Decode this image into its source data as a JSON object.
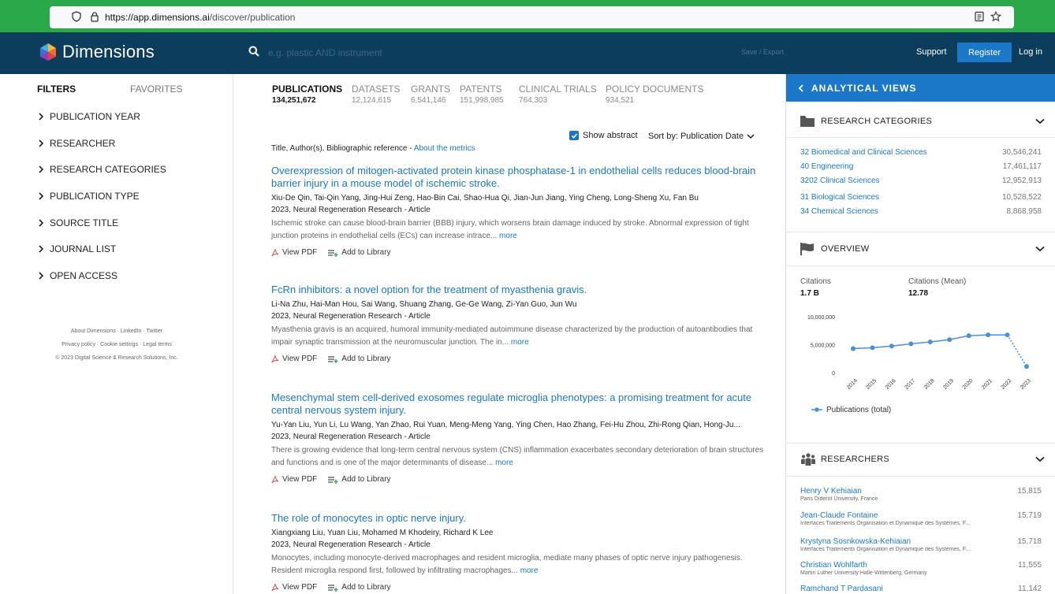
{
  "browser": {
    "url_host_prefix": "https://app.",
    "url_host": "dimensions.ai",
    "url_path": "/discover/publication"
  },
  "header": {
    "logo_text": "Dimensions",
    "search_placeholder": "e.g. plastic AND instrument",
    "save_export": "Save / Export",
    "support": "Support",
    "register": "Register",
    "login": "Log in",
    "colors": {
      "header_bg": "#0c3d5c",
      "accent": "#1b78c8",
      "browser_bar": "#2ba84a"
    }
  },
  "filters": {
    "tab_active": "FILTERS",
    "tab_other": "FAVORITES",
    "items": [
      {
        "label": "PUBLICATION YEAR"
      },
      {
        "label": "RESEARCHER"
      },
      {
        "label": "RESEARCH CATEGORIES"
      },
      {
        "label": "PUBLICATION TYPE"
      },
      {
        "label": "SOURCE TITLE"
      },
      {
        "label": "JOURNAL LIST"
      },
      {
        "label": "OPEN ACCESS"
      }
    ],
    "footer": {
      "line1": "About Dimensions · LinkedIn · Twitter",
      "line2": "Privacy policy · Cookie settings · Legal terms",
      "line3": "© 2023 Digital Science & Research Solutions, Inc."
    }
  },
  "main": {
    "tabs": [
      {
        "label": "PUBLICATIONS",
        "count": "134,251,672"
      },
      {
        "label": "DATASETS",
        "count": "12,124,615"
      },
      {
        "label": "GRANTS",
        "count": "6,541,146"
      },
      {
        "label": "PATENTS",
        "count": "151,998,985"
      },
      {
        "label": "CLINICAL TRIALS",
        "count": "764,303"
      },
      {
        "label": "POLICY DOCUMENTS",
        "count": "934,521"
      }
    ],
    "show_abstract": "Show abstract",
    "sort_by": "Sort by: Publication Date",
    "title_ref": "Title, Author(s), Bibliographic reference - ",
    "about_metrics": "About the metrics",
    "view_pdf": "View PDF",
    "add_to_library": "Add to Library",
    "more": "more",
    "results": [
      {
        "title": "Overexpression of mitogen-activated protein kinase phosphatase-1 in endothelial cells reduces blood-brain barrier injury in a mouse model of ischemic stroke.",
        "authors": "Xiu-De Qin, Tai-Qin Yang, Jing-Hui Zeng, Hao-Bin Cai, Shao-Hua Qi, Jian-Jun Jiang, Ying Cheng, Long-Sheng Xu, Fan Bu",
        "source": "2023, Neural Regeneration Research - Article",
        "abstract": "Ischemic stroke can cause blood-brain barrier (BBB) injury, which worsens brain damage induced by stroke. Abnormal expression of tight junction proteins in endothelial cells (ECs) can increase intrace... "
      },
      {
        "title": "FcRn inhibitors: a novel option for the treatment of myasthenia gravis.",
        "authors": "Li-Na Zhu, Hai-Man Hou, Sai Wang, Shuang Zhang, Ge-Ge Wang, Zi-Yan Guo, Jun Wu",
        "source": "2023, Neural Regeneration Research - Article",
        "abstract": "Myasthenia gravis is an acquired, humoral immunity-mediated autoimmune disease characterized by the production of autoantibodies that impair synaptic transmission at the neuromuscular junction. The in... "
      },
      {
        "title": "Mesenchymal stem cell-derived exosomes regulate microglia phenotypes: a promising treatment for acute central nervous system injury.",
        "authors": "Yu-Yan Liu, Yun Li, Lu Wang, Yan Zhao, Rui Yuan, Meng-Meng Yang, Ying Chen, Hao Zhang, Fei-Hu Zhou, Zhi-Rong Qian, Hong-Ju...",
        "source": "2023, Neural Regeneration Research - Article",
        "abstract": "There is growing evidence that long-term central nervous system (CNS) inflammation exacerbates secondary deterioration of brain structures and functions and is one of the major determinants of disease... "
      },
      {
        "title": "The role of monocytes in optic nerve injury.",
        "authors": "Xiangxiang Liu, Yuan Liu, Mohamed M Khodeiry, Richard K Lee",
        "source": "2023, Neural Regeneration Research - Article",
        "abstract": "Monocytes, including monocyte-derived macrophages and resident microglia, mediate many phases of optic nerve injury pathogenesis. Resident microglia respond first, followed by infiltrating macrophages... "
      }
    ]
  },
  "right": {
    "header": "ANALYTICAL VIEWS",
    "research_categories": {
      "title": "RESEARCH CATEGORIES",
      "items": [
        {
          "name": "32 Biomedical and Clinical Sciences",
          "value": "30,546,241"
        },
        {
          "name": "40 Engineering",
          "value": "17,461,117"
        },
        {
          "name": "3202 Clinical Sciences",
          "value": "12,952,913"
        },
        {
          "name": "31 Biological Sciences",
          "value": "10,528,522"
        },
        {
          "name": "34 Chemical Sciences",
          "value": "8,868,958"
        }
      ]
    },
    "overview": {
      "title": "OVERVIEW",
      "citations_label": "Citations",
      "citations_value": "1.7 B",
      "mean_label": "Citations (Mean)",
      "mean_value": "12.78"
    },
    "researchers": {
      "title": "RESEARCHERS",
      "items": [
        {
          "name": "Henry V Kehiaian",
          "affiliation": "Paris Diderot University, France",
          "value": "15,815"
        },
        {
          "name": "Jean-Claude Fontaine",
          "affiliation": "Interfaces Traitements Organisation et Dynamique des Systèmes, F...",
          "value": "15,719"
        },
        {
          "name": "Krystyna Sosnkowska-Kehiaian",
          "affiliation": "Interfaces Traitements Organisation et Dynamique des Systèmes, F...",
          "value": "15,718"
        },
        {
          "name": "Christian Wohlfarth",
          "affiliation": "Martin Luther University Halle-Wittenberg, Germany",
          "value": "11,555"
        },
        {
          "name": "Ramchand T Pardasani",
          "affiliation": "",
          "value": "11,142"
        }
      ]
    }
  },
  "chart_data": {
    "type": "line",
    "x": [
      "2014",
      "2015",
      "2016",
      "2017",
      "2018",
      "2019",
      "2020",
      "2021",
      "2022",
      "2023"
    ],
    "series": [
      {
        "name": "Publications (total)",
        "values": [
          4300000,
          4450000,
          4750000,
          5150000,
          5500000,
          5900000,
          6600000,
          6750000,
          6750000,
          1100000
        ]
      }
    ],
    "yticks": [
      "0",
      "5,000,000",
      "10,000,000"
    ],
    "ylim": [
      0,
      10000000
    ],
    "last_segment_dotted": true,
    "legend_position": "bottom-left",
    "grid": false
  }
}
